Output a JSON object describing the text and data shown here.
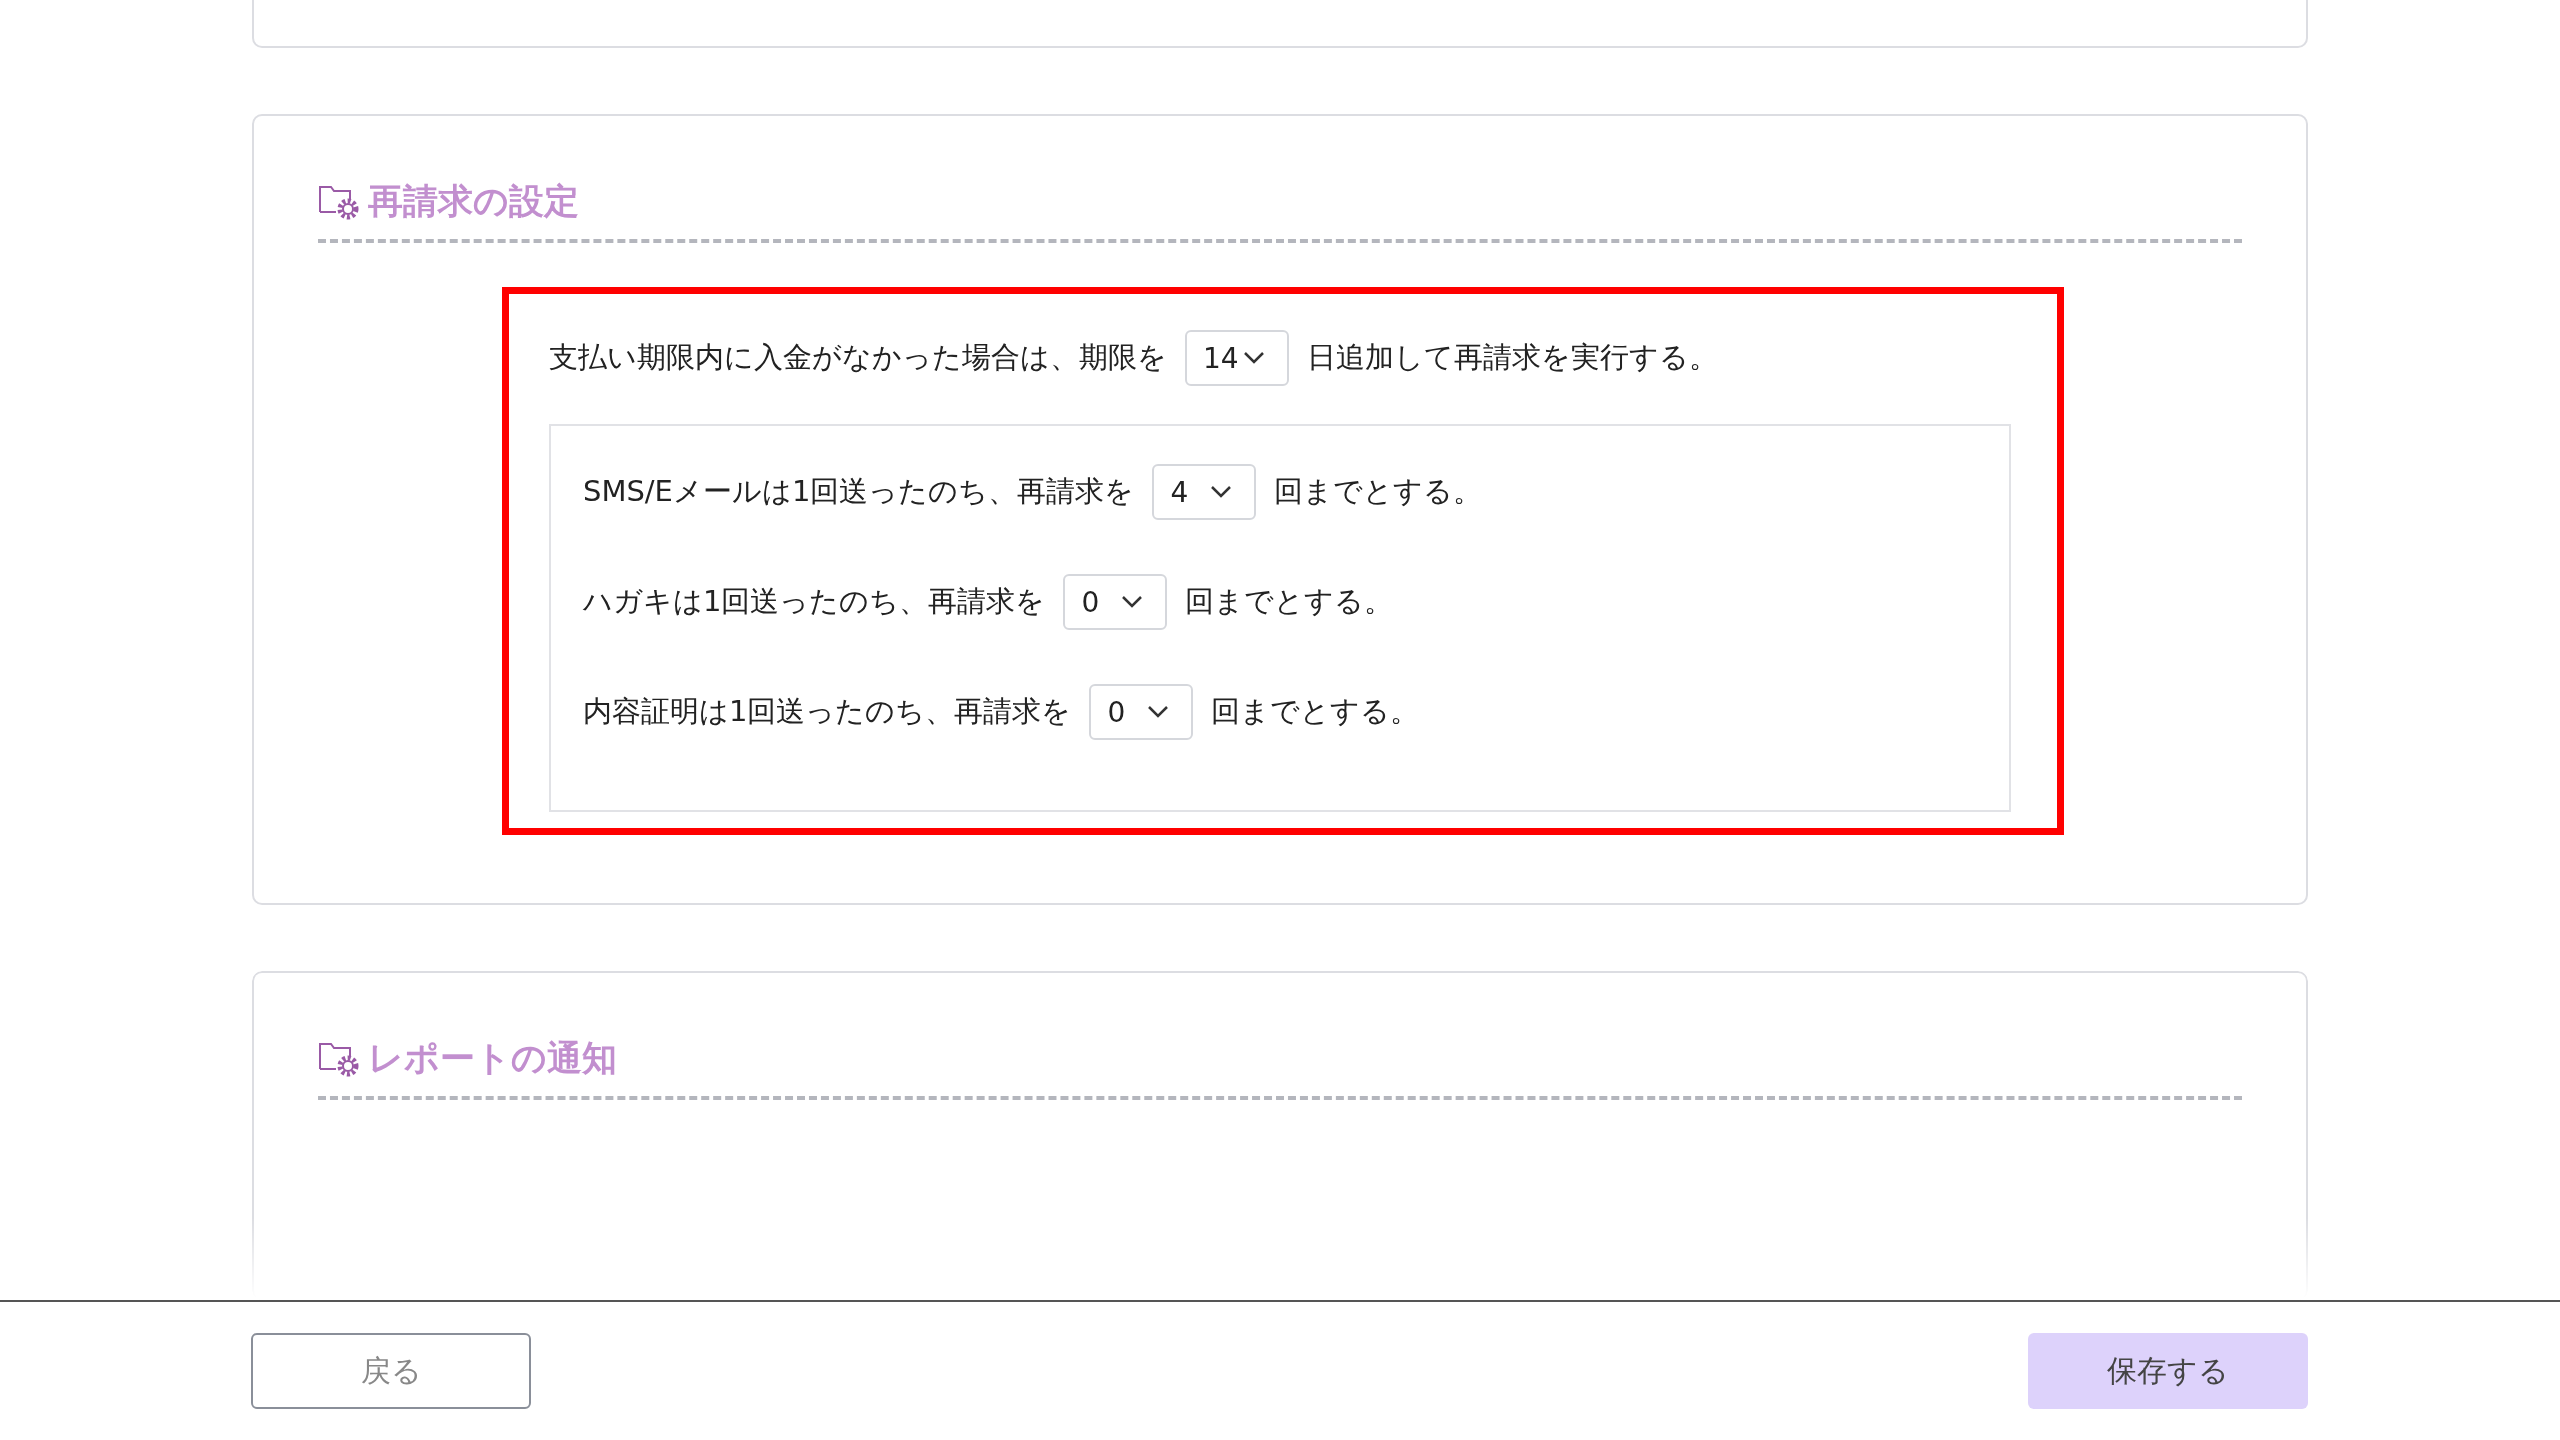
{
  "sections": [
    {
      "title": "再請求の設定",
      "main_rule": {
        "before": "支払い期限内に入金がなかった場合は、期限を",
        "value": "14",
        "after": "日追加して再請求を実行する。"
      },
      "rules": [
        {
          "before": "SMS/Eメールは1回送ったのち、再請求を",
          "value": "4",
          "after": "回までとする。"
        },
        {
          "before": "ハガキは1回送ったのち、再請求を",
          "value": "0",
          "after": "回までとする。"
        },
        {
          "before": "内容証明は1回送ったのち、再請求を",
          "value": "0",
          "after": "回までとする。"
        }
      ]
    },
    {
      "title": "レポートの通知"
    }
  ],
  "footer": {
    "back": "戻る",
    "save": "保存する"
  }
}
